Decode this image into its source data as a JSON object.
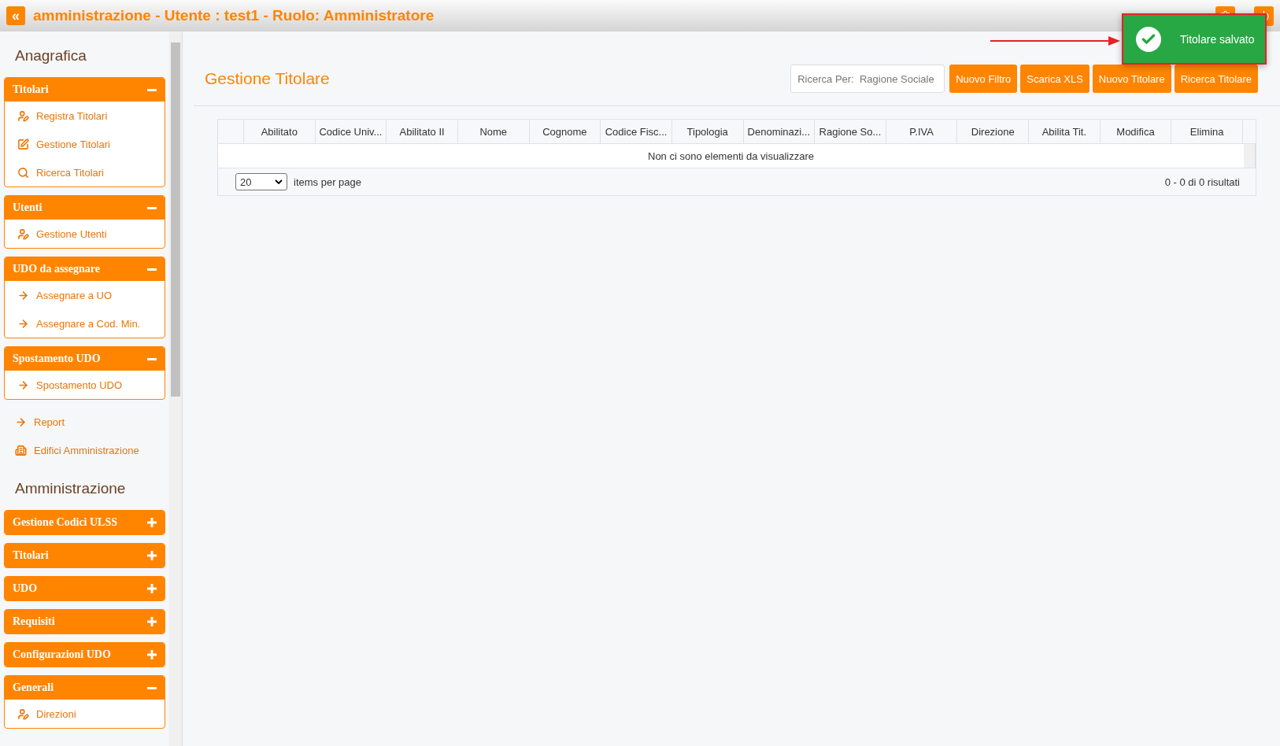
{
  "header": {
    "title": "amministrazione - Utente : test1 - Ruolo: Amministratore",
    "toggle": "«"
  },
  "toast": {
    "message": "Titolare salvato"
  },
  "sidebar": {
    "sections": [
      {
        "heading": "Anagrafica",
        "entries": [
          {
            "kind": "group",
            "title": "Titolari",
            "expanded": true,
            "items": [
              {
                "label": "Registra Titolari",
                "kind": "user"
              },
              {
                "label": "Gestione Titolari",
                "kind": "edit"
              },
              {
                "label": "Ricerca Titolari",
                "kind": "search"
              }
            ]
          },
          {
            "kind": "group",
            "title": "Utenti",
            "expanded": true,
            "items": [
              {
                "label": "Gestione Utenti",
                "kind": "user"
              }
            ]
          },
          {
            "kind": "group",
            "title": "UDO da assegnare",
            "expanded": true,
            "items": [
              {
                "label": "Assegnare a UO",
                "kind": "arrow"
              },
              {
                "label": "Assegnare a Cod. Min.",
                "kind": "arrow"
              }
            ]
          },
          {
            "kind": "group",
            "title": "Spostamento UDO",
            "expanded": true,
            "items": [
              {
                "label": "Spostamento UDO",
                "kind": "arrow"
              }
            ]
          },
          {
            "kind": "arrow_link",
            "label": "Report"
          },
          {
            "kind": "building_link",
            "label": "Edifici Amministrazione"
          }
        ]
      },
      {
        "heading": "Amministrazione",
        "entries": [
          {
            "kind": "group",
            "title": "Gestione Codici ULSS",
            "expanded": false
          },
          {
            "kind": "group",
            "title": "Titolari",
            "expanded": false
          },
          {
            "kind": "group",
            "title": "UDO",
            "expanded": false
          },
          {
            "kind": "group",
            "title": "Requisiti",
            "expanded": false
          },
          {
            "kind": "group",
            "title": "Configurazioni UDO",
            "expanded": false
          },
          {
            "kind": "group",
            "title": "Generali",
            "expanded": true,
            "items": [
              {
                "label": "Direzioni",
                "kind": "user"
              }
            ]
          }
        ]
      }
    ]
  },
  "page": {
    "title": "Gestione Titolare",
    "search": {
      "placeholder": "Ricerca Per:  Ragione Sociale"
    },
    "buttons": [
      "Nuovo Filtro",
      "Scarica XLS",
      "Nuovo Titolare",
      "Ricerca Titolare"
    ],
    "table": {
      "columns": [
        "Abilitato",
        "Codice Univ...",
        "Abilitato II",
        "Nome",
        "Cognome",
        "Codice Fisc...",
        "Tipologia",
        "Denominazi...",
        "Ragione So...",
        "P.IVA",
        "Direzione",
        "Abilita Tit.",
        "Modifica",
        "Elimina"
      ],
      "empty_message": "Non ci sono elementi da visualizzare",
      "rows_shown": "20",
      "rows_shown_label": "items per page",
      "summary": "0 - 0 di 0 risultati"
    }
  }
}
